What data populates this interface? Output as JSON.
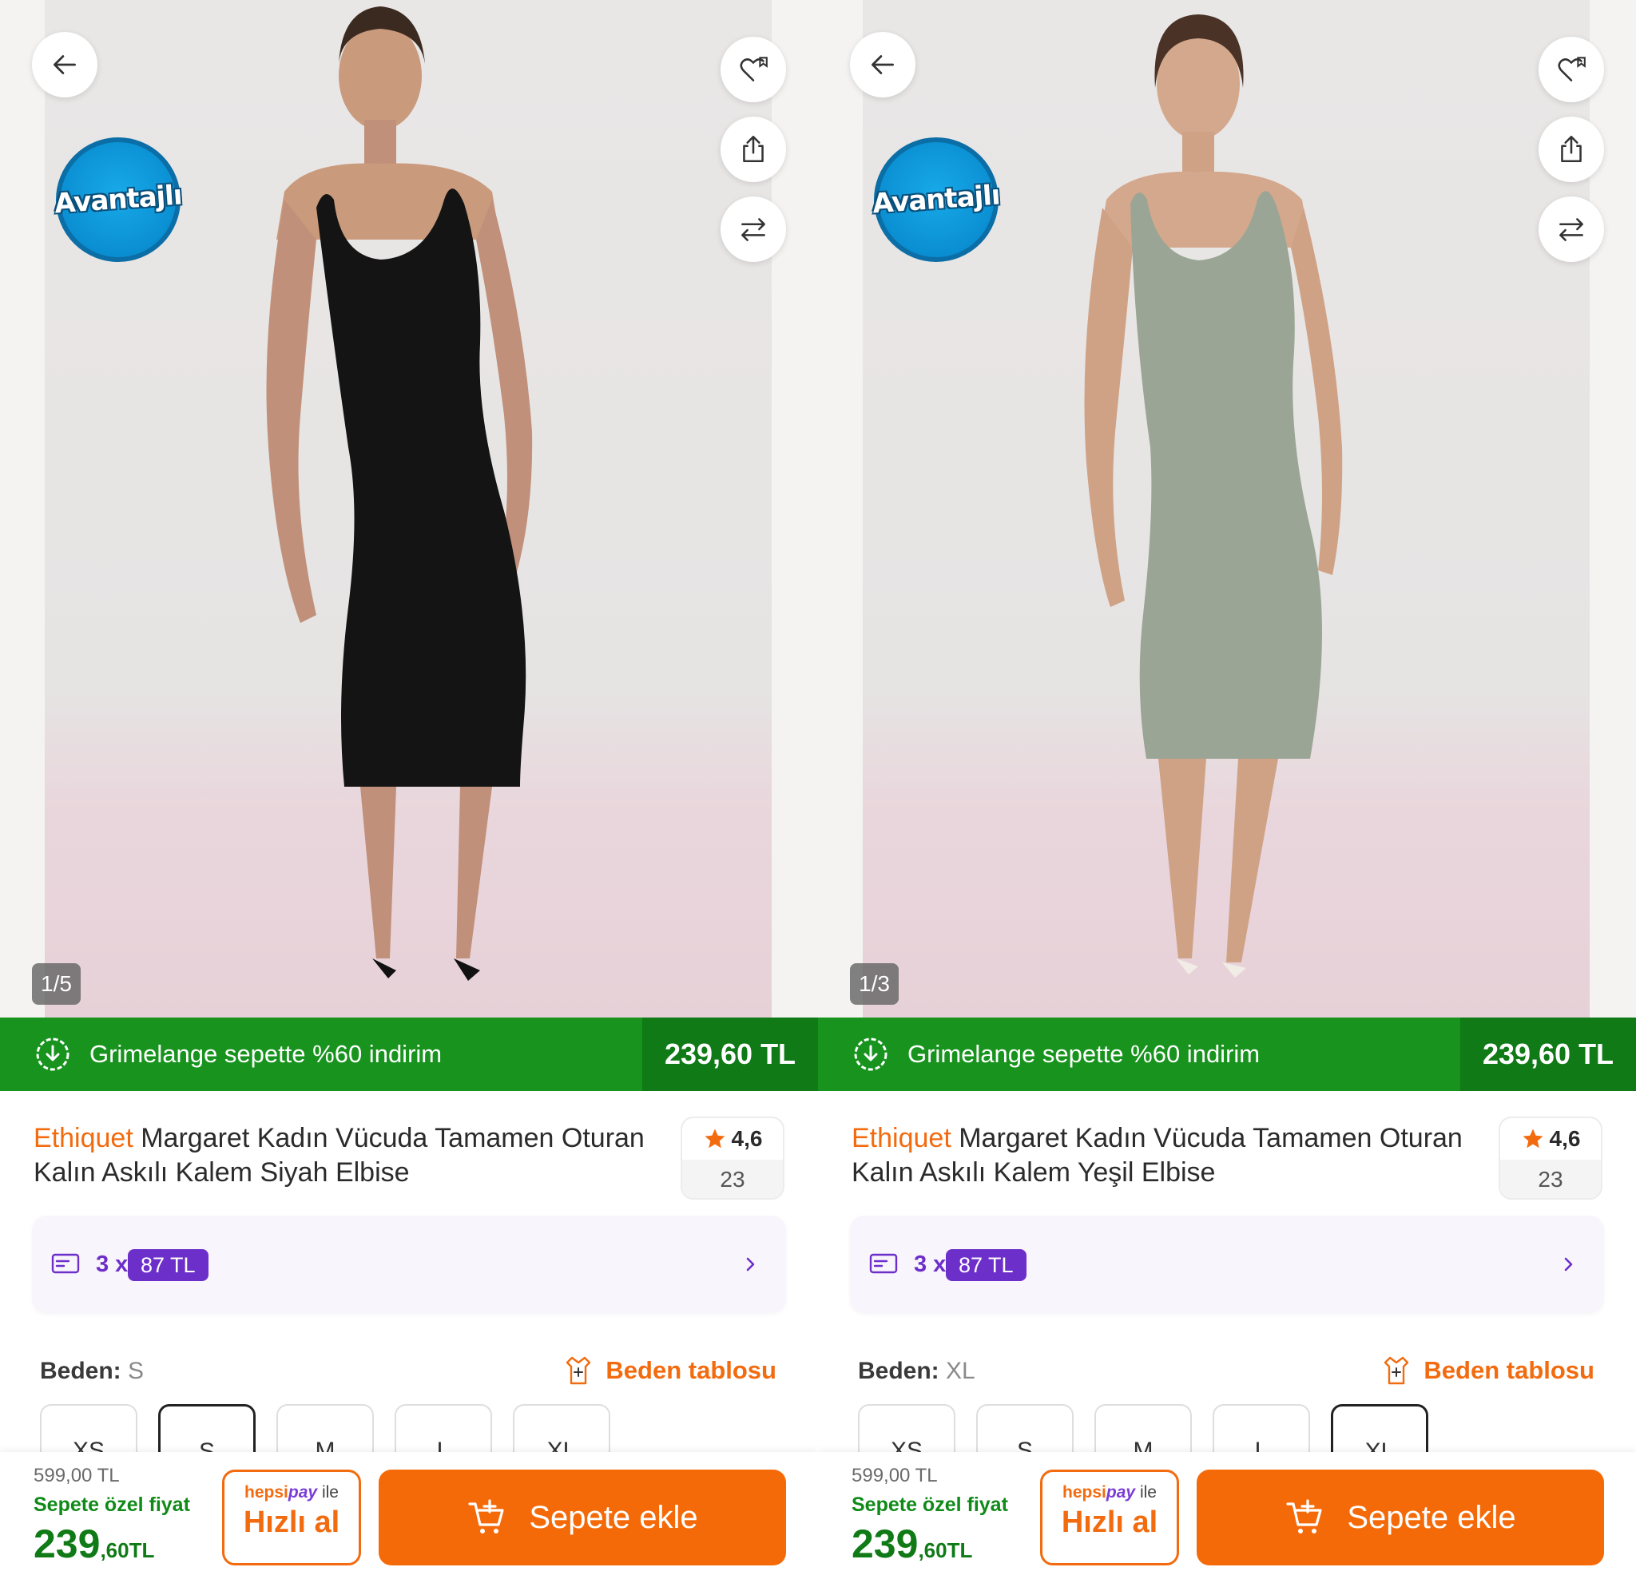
{
  "panels": [
    {
      "image_counter": "1/5",
      "badge": "Avantajlı",
      "promo": {
        "text": "Grimelange sepette %60 indirim",
        "price": "239,60 TL"
      },
      "product": {
        "brand": "Ethiquet",
        "title": "Margaret Kadın Vücuda Tamamen Oturan Kalın Askılı Kalem Siyah Elbise",
        "rating": "4,6",
        "review_count": "23"
      },
      "installment": {
        "count": "3 x",
        "amount": "87 TL"
      },
      "size": {
        "label": "Beden:",
        "selected": "S",
        "chart_link": "Beden tablosu",
        "options": [
          "XS",
          "S",
          "M",
          "L",
          "XL"
        ]
      },
      "bottom": {
        "old_price": "599,00 TL",
        "special_label": "Sepete özel fiyat",
        "price_int": "239",
        "price_dec": ",60TL",
        "hepsipay_hepsi": "hepsi",
        "hepsipay_pay": "pay",
        "hepsipay_ile": "ile",
        "quick_buy": "Hızlı al",
        "add_to_cart": "Sepete ekle"
      },
      "dress_color": "#141414"
    },
    {
      "image_counter": "1/3",
      "badge": "Avantajlı",
      "promo": {
        "text": "Grimelange sepette %60 indirim",
        "price": "239,60 TL"
      },
      "product": {
        "brand": "Ethiquet",
        "title": "Margaret Kadın Vücuda Tamamen Oturan Kalın Askılı Kalem Yeşil Elbise",
        "rating": "4,6",
        "review_count": "23"
      },
      "installment": {
        "count": "3 x",
        "amount": "87 TL"
      },
      "size": {
        "label": "Beden:",
        "selected": "XL",
        "chart_link": "Beden tablosu",
        "options": [
          "XS",
          "S",
          "M",
          "L",
          "XL"
        ]
      },
      "bottom": {
        "old_price": "599,00 TL",
        "special_label": "Sepete özel fiyat",
        "price_int": "239",
        "price_dec": ",60TL",
        "hepsipay_hepsi": "hepsi",
        "hepsipay_pay": "pay",
        "hepsipay_ile": "ile",
        "quick_buy": "Hızlı al",
        "add_to_cart": "Sepete ekle"
      },
      "dress_color": "#9aa595"
    }
  ],
  "colors": {
    "brand_orange": "#f26b0f",
    "promo_green": "#18941e",
    "price_green": "#0f7a16",
    "installment_purple": "#6d2fc9"
  },
  "icons": [
    "back-arrow-icon",
    "favorite-heart-icon",
    "share-icon",
    "compare-icon",
    "discount-icon",
    "star-icon",
    "card-icon",
    "chevron-right-icon",
    "size-chart-icon",
    "cart-add-icon"
  ]
}
